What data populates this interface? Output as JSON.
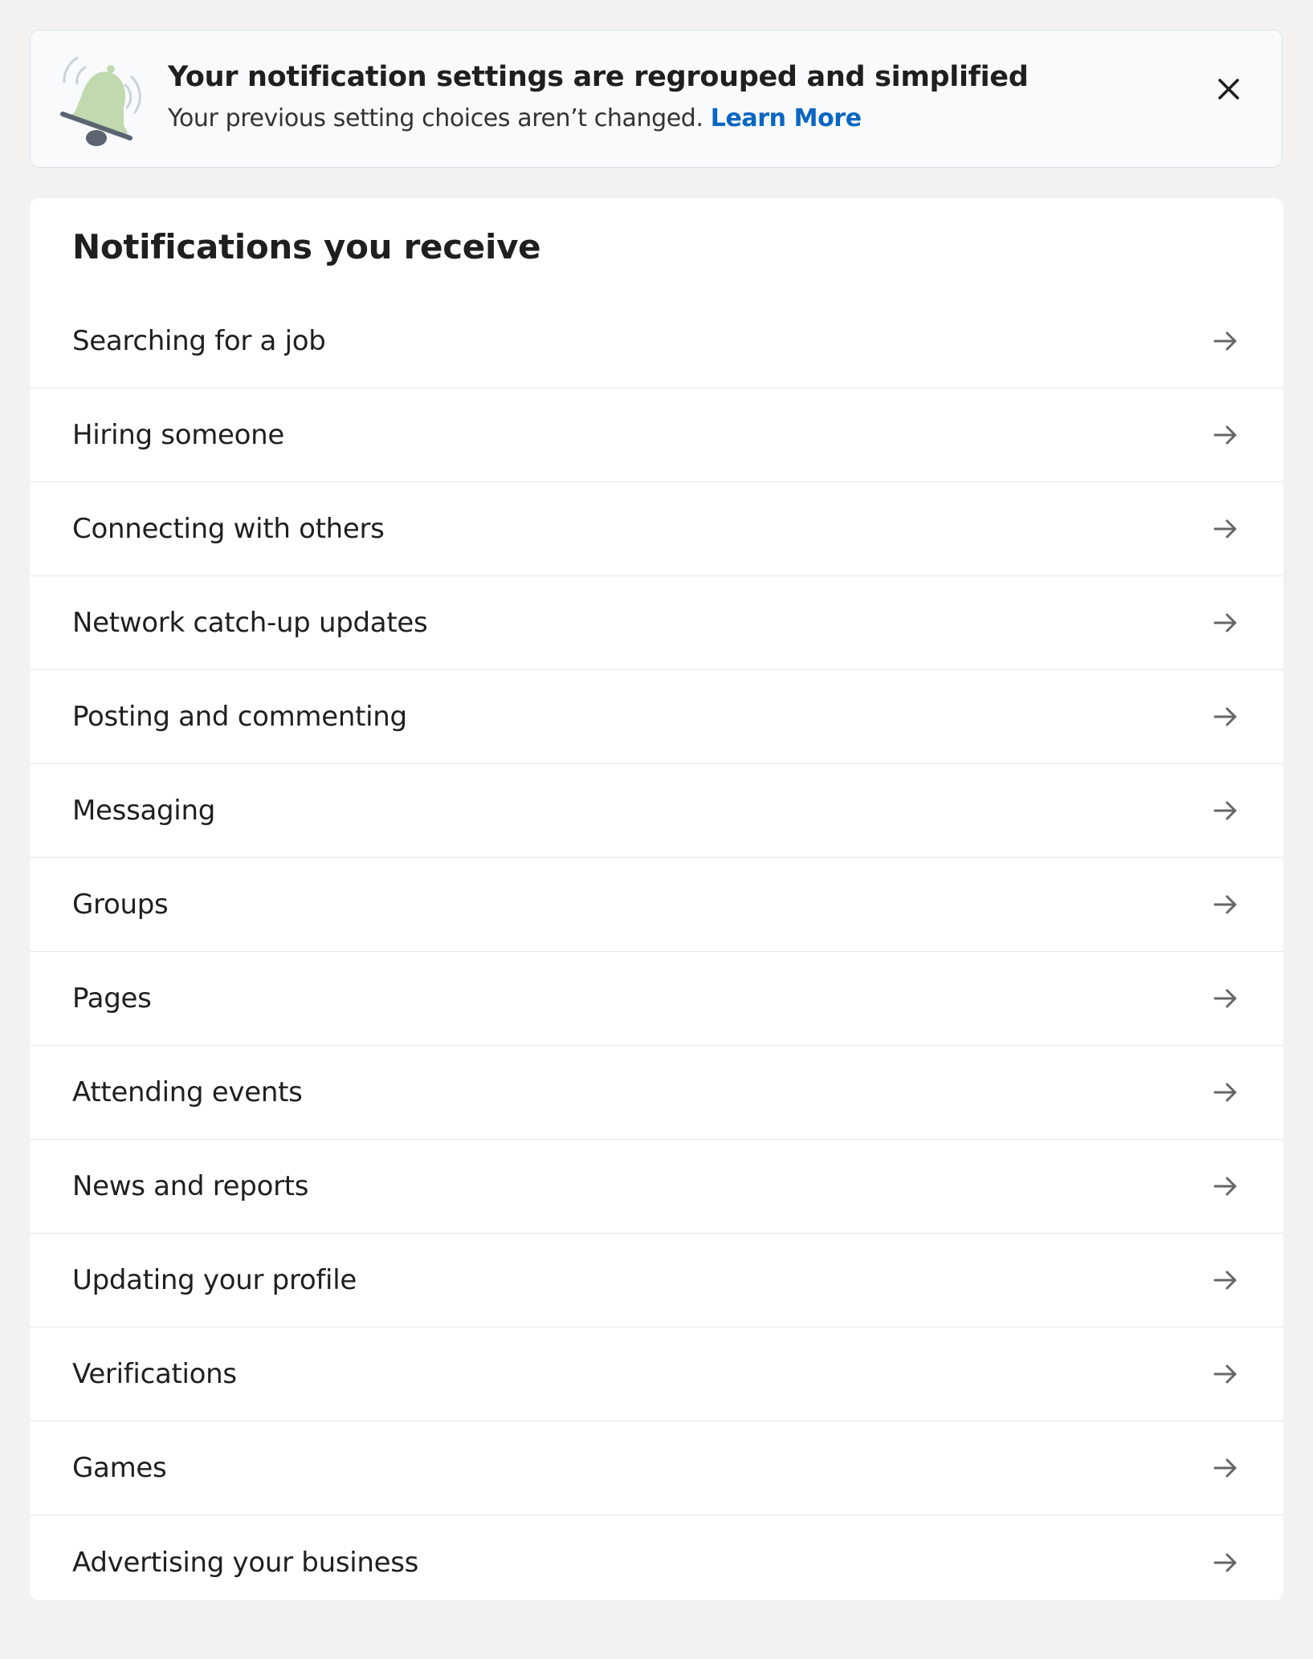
{
  "banner": {
    "icon": "bell-slash-icon",
    "title": "Your notification settings are regrouped and simplified",
    "subtitle": "Your previous setting choices aren’t changed.",
    "link_label": "Learn More",
    "close_icon": "close-icon"
  },
  "section": {
    "title": "Notifications you receive",
    "row_icon": "arrow-right-icon",
    "items": [
      {
        "label": "Searching for a job"
      },
      {
        "label": "Hiring someone"
      },
      {
        "label": "Connecting with others"
      },
      {
        "label": "Network catch-up updates"
      },
      {
        "label": "Posting and commenting"
      },
      {
        "label": "Messaging"
      },
      {
        "label": "Groups"
      },
      {
        "label": "Pages"
      },
      {
        "label": "Attending events"
      },
      {
        "label": "News and reports"
      },
      {
        "label": "Updating your profile"
      },
      {
        "label": "Verifications"
      },
      {
        "label": "Games"
      },
      {
        "label": "Advertising your business"
      }
    ]
  },
  "colors": {
    "page_background": "#f3f2f0",
    "card_background": "#ffffff",
    "banner_background": "#f8fafc",
    "link": "#0a66c2",
    "bell_fill": "#c0d9ae",
    "arrow": "#666666"
  }
}
